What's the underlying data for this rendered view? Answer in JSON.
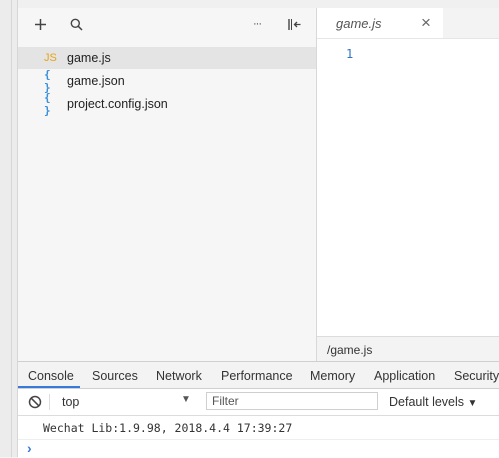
{
  "explorer": {
    "toolbar": {
      "add_icon": "plus-icon",
      "search_icon": "search-icon",
      "more_label": "···",
      "collapse_icon": "collapse-panel-icon"
    },
    "files": [
      {
        "icon": "JS",
        "label": "game.js",
        "selected": true
      },
      {
        "icon": "{ }",
        "label": "game.json",
        "selected": false
      },
      {
        "icon": "{ }",
        "label": "project.config.json",
        "selected": false
      }
    ]
  },
  "editor": {
    "tab_title": "game.js",
    "tab_close": "×",
    "line_numbers": [
      "1"
    ],
    "status_path": "/game.js"
  },
  "devtools": {
    "tabs": [
      "Console",
      "Sources",
      "Network",
      "Performance",
      "Memory",
      "Application",
      "Security"
    ],
    "active_tab": "Console",
    "context_value": "top",
    "filter_placeholder": "Filter",
    "levels_label": "Default levels",
    "log_line": "Wechat Lib:1.9.98, 2018.4.4 17:39:27",
    "prompt": "›"
  },
  "colors": {
    "accent": "#3879d9",
    "js_icon": "#e8a31a",
    "json_icon": "#3a8fd8",
    "line_number": "#2f74c0"
  }
}
